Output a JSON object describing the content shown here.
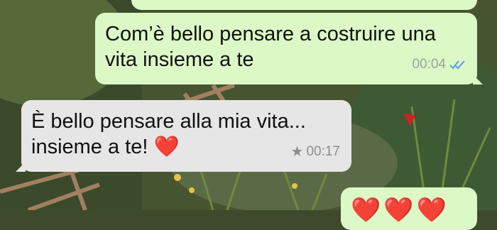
{
  "messages": [
    {
      "direction": "outgoing",
      "text_line1": "Com’è bello pensare a costruire una",
      "text_line2": "vita insieme a te",
      "time": "00:04",
      "status_icon": "double-check-read-icon",
      "status_color": "#4fa3e6"
    },
    {
      "direction": "incoming",
      "text_line1": "È bello pensare alla mia vita...",
      "text_line2": "insieme a te! ❤️",
      "time": "00:17",
      "starred_icon": "star-icon"
    },
    {
      "direction": "outgoing",
      "text": "❤️❤️❤️"
    }
  ],
  "colors": {
    "outgoing_bubble": "#dcf8c6",
    "incoming_bubble": "#e6e6e6",
    "read_tick": "#4fa3e6"
  }
}
